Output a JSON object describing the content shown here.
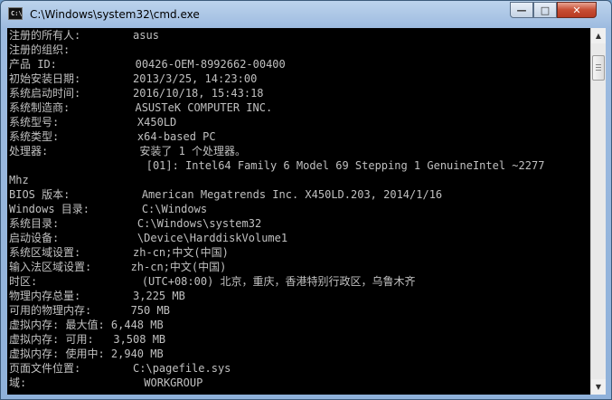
{
  "window": {
    "title": "C:\\Windows\\system32\\cmd.exe",
    "icon_label": "C:\\",
    "buttons": {
      "minimize": "—",
      "maximize": "□",
      "close": "✕"
    }
  },
  "console": {
    "lines": [
      "注册的所有人:        asus",
      "注册的组织:",
      "产品 ID:            00426-OEM-8992662-00400",
      "初始安装日期:        2013/3/25, 14:23:00",
      "系统启动时间:        2016/10/18, 15:43:18",
      "系统制造商:          ASUSTeK COMPUTER INC.",
      "系统型号:            X450LD",
      "系统类型:            x64-based PC",
      "处理器:              安装了 1 个处理器。",
      "                     [01]: Intel64 Family 6 Model 69 Stepping 1 GenuineIntel ~2277",
      "Mhz",
      "BIOS 版本:           American Megatrends Inc. X450LD.203, 2014/1/16",
      "Windows 目录:        C:\\Windows",
      "系统目录:            C:\\Windows\\system32",
      "启动设备:            \\Device\\HarddiskVolume1",
      "系统区域设置:        zh-cn;中文(中国)",
      "输入法区域设置:      zh-cn;中文(中国)",
      "时区:                (UTC+08:00) 北京，重庆，香港特别行政区，乌鲁木齐",
      "物理内存总量:        3,225 MB",
      "可用的物理内存:      750 MB",
      "虚拟内存: 最大值: 6,448 MB",
      "虚拟内存: 可用:   3,508 MB",
      "虚拟内存: 使用中: 2,940 MB",
      "页面文件位置:        C:\\pagefile.sys",
      "域:                  WORKGROUP"
    ]
  },
  "scrollbar": {
    "up_arrow": "▲",
    "down_arrow": "▼"
  },
  "colors": {
    "console_bg": "#000000",
    "console_text": "#c0c0c0",
    "close_button": "#c74d33"
  }
}
